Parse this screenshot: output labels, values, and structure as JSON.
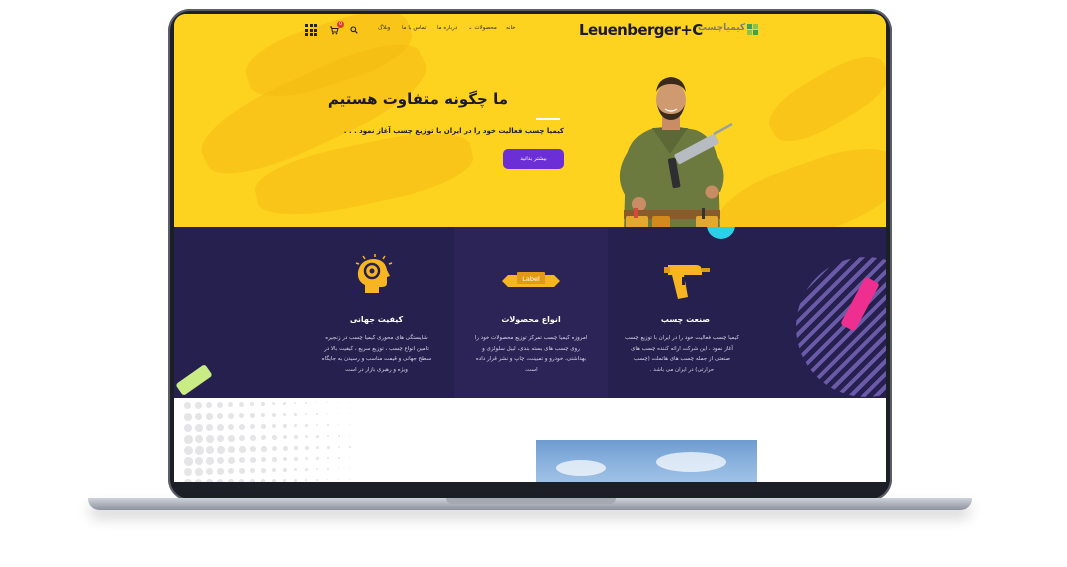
{
  "brand": {
    "logo_text": "Leuenberger+C",
    "logo_fa": "کیمیاچسب",
    "accent_color": "#fdd31f",
    "button_color": "#6c2fd6",
    "dark_color": "#26204e"
  },
  "nav": {
    "home": "خانه",
    "products": "محصولات",
    "about": "درباره ما",
    "contact": "تماس با ما",
    "blog": "وبلاگ",
    "cart_count": "0",
    "search_icon": "search-icon",
    "cart_icon": "cart-icon",
    "menu_icon": "grid-menu-icon"
  },
  "hero": {
    "title": "ما چگونه متفاوت هستیم",
    "subtitle": "کیمیا چسب فعالیت خود را در ایران با توزیع چسب آغاز نمود . . .",
    "button_label": "بیشتر بدانید"
  },
  "features": [
    {
      "icon": "glue-gun-icon",
      "title": "صنعت چسب",
      "lines": [
        "کیمیا چسب فعالیت خود را در ایران با توزیع چسب",
        "آغاز نمود ، این شرکت ارائه کننده چسب های",
        "صنعتی از جمله چسب های هاتملت (چسب",
        "حرارتی) در ایران می باشد ."
      ]
    },
    {
      "icon": "label-icon",
      "icon_text": "Label",
      "title": "انواع محصولات",
      "lines": [
        "امروزه کیمیا چسب تمرکز توزیع محصولات خود را",
        "روی چسب های بسته بندی، لیبل سلولزی و",
        "بهداشتی، خودرو و تمبینت، چاپ و نشر قرار داده",
        "است."
      ]
    },
    {
      "icon": "gear-head-icon",
      "title": "کیفیت جهانی",
      "lines": [
        "شایستگی های محوری کیمیا چسب در زنجیره",
        "تامین انواع چسب ، توزیع سریع ، کیفیت بالا در",
        "سطح جهانی و قیمت مناسب و رسیدن به جایگاه",
        "ویژه و رهبری بازار در است"
      ]
    }
  ]
}
